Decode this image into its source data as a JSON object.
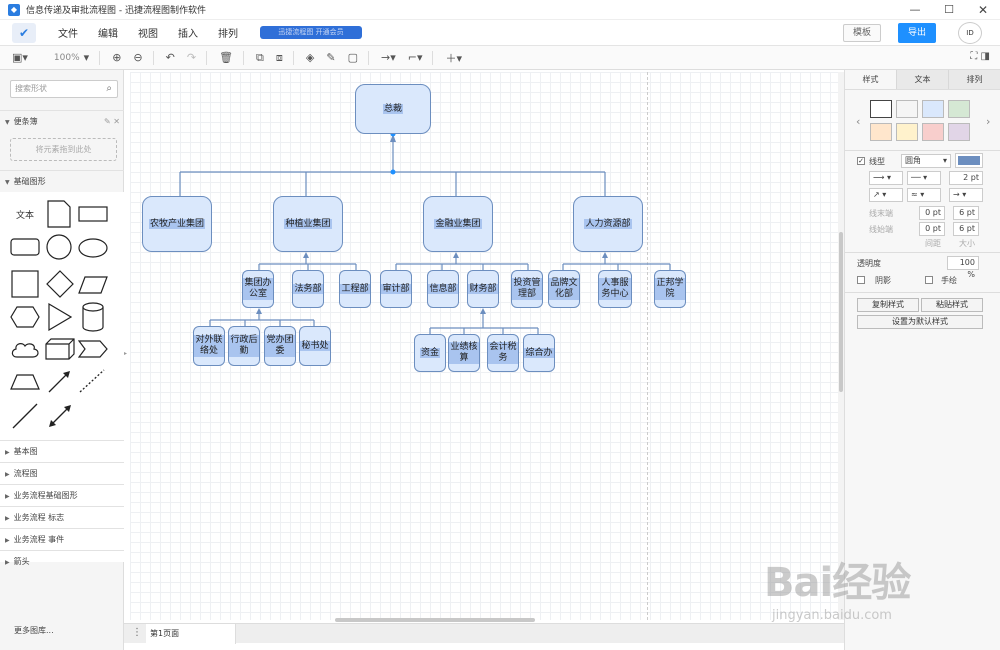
{
  "window": {
    "title": "信息传递及审批流程图 - 迅捷流程图制作软件",
    "controls": [
      "—",
      "☐",
      "✕"
    ]
  },
  "menubar": {
    "items": [
      "文件",
      "编辑",
      "视图",
      "插入",
      "排列"
    ],
    "promo": "迅捷流程图 开通会员",
    "template_label": "模板",
    "export_label": "导出",
    "avatar_text": "ID"
  },
  "toolbar": {
    "zoom": "100%"
  },
  "leftpanel": {
    "search_placeholder": "搜索形状",
    "scratchpad_title": "便条簿",
    "drop_zone_text": "将元素拖到此处",
    "basic_shapes_title": "基础图形",
    "text_shape_label": "文本",
    "categories": [
      "基本图",
      "流程图",
      "业务流程基础图形",
      "业务流程 标志",
      "业务流程 事件",
      "箭头"
    ],
    "more_libraries": "更多图库..."
  },
  "diagram": {
    "root": "总裁",
    "level1": [
      "农牧产业集团",
      "种植业集团",
      "金融业集团",
      "人力资源部"
    ],
    "planting_children": [
      "集团办公室",
      "法务部",
      "工程部"
    ],
    "office_children": [
      "对外联络处",
      "行政后勤",
      "党办团委",
      "秘书处"
    ],
    "finance_children": [
      "审计部",
      "信息部",
      "财务部",
      "投资管理部"
    ],
    "finance_dept_children": [
      "资金",
      "业绩核算",
      "会计税务",
      "综合办"
    ],
    "hr_children": [
      "品牌文化部",
      "人事服务中心",
      "正邦学院"
    ]
  },
  "pagebar": {
    "page_tab": "第1页面"
  },
  "rightpanel": {
    "tabs": [
      "样式",
      "文本",
      "排列"
    ],
    "swatch_colors": [
      "#ffffff",
      "#f5f5f5",
      "#dae8fc",
      "#d5e8d4",
      "#ffe6cc",
      "#fff2cc",
      "#f8cecc",
      "#e1d5e7"
    ],
    "line_label": "线型",
    "line_style": "圆角",
    "line_color": "#6c8ebf",
    "line_width": "2 pt",
    "line_end_label": "线末端",
    "line_start_label": "线始端",
    "end_spacing": "0 pt",
    "end_size": "6 pt",
    "start_spacing": "0 pt",
    "start_size": "6 pt",
    "spacing_label": "间距",
    "size_label": "大小",
    "opacity_label": "透明度",
    "opacity_value": "100 %",
    "shadow_label": "阴影",
    "sketch_label": "手绘",
    "copy_style": "复制样式",
    "paste_style": "粘贴样式",
    "set_default": "设置为默认样式"
  },
  "watermark": {
    "text": "Bai经验",
    "url": "jingyan.baidu.com"
  }
}
